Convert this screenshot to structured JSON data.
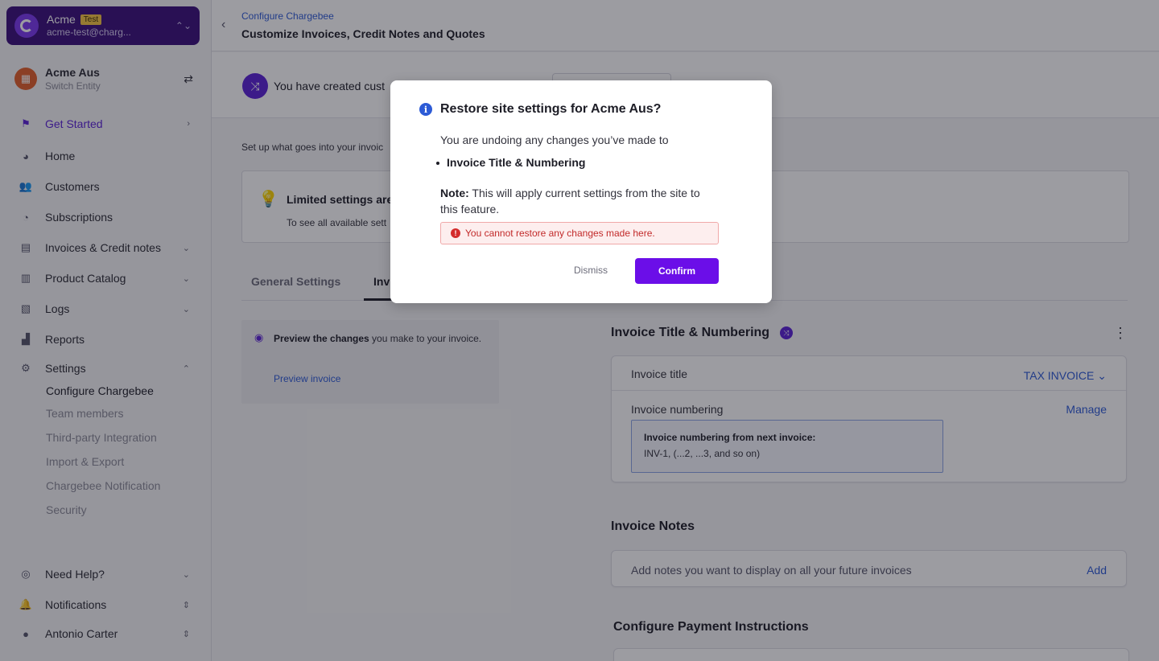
{
  "account": {
    "name": "Acme",
    "badge": "Test",
    "email": "acme-test@charg..."
  },
  "entity": {
    "name": "Acme Aus",
    "sub": "Switch Entity"
  },
  "nav": {
    "get_started": "Get Started",
    "home": "Home",
    "customers": "Customers",
    "subscriptions": "Subscriptions",
    "invoices": "Invoices & Credit notes",
    "product_catalog": "Product Catalog",
    "logs": "Logs",
    "reports": "Reports",
    "settings": "Settings",
    "settings_sub": [
      "Configure Chargebee",
      "Team members",
      "Third-party Integration",
      "Import & Export",
      "Chargebee Notification",
      "Security"
    ],
    "need_help": "Need Help?",
    "notifications": "Notifications",
    "user": "Antonio Carter"
  },
  "header": {
    "breadcrumb": "Configure Chargebee",
    "title": "Customize Invoices, Credit Notes and Quotes"
  },
  "banner": {
    "text": "You have created cust"
  },
  "setup_text": "Set up what goes into your invoic",
  "limited": {
    "title": "Limited settings are",
    "text": "To see all available sett"
  },
  "tabs": {
    "general": "General Settings",
    "invoices": "Inv"
  },
  "preview": {
    "bold": "Preview the changes",
    "rest": " you make to your invoice.",
    "link": "Preview invoice"
  },
  "title_numbering": {
    "heading": "Invoice Title & Numbering",
    "title_label": "Invoice title",
    "title_value": "TAX INVOICE",
    "numbering_label": "Invoice numbering",
    "manage": "Manage",
    "box_heading": "Invoice numbering from next invoice:",
    "box_value": "INV-1, (...2, ...3, and so on)"
  },
  "notes": {
    "heading": "Invoice Notes",
    "text": "Add notes you want to display on all your future invoices",
    "add": "Add"
  },
  "payment": {
    "heading": "Configure Payment Instructions"
  },
  "modal": {
    "title": "Restore site settings for Acme Aus?",
    "body": "You are undoing any changes you’ve made to",
    "bullet": "Invoice Title & Numbering",
    "note_label": "Note:",
    "note_text": " This will apply current settings from the site to this feature.",
    "error": "You cannot restore any changes made here.",
    "dismiss": "Dismiss",
    "confirm": "Confirm"
  },
  "colors": {
    "accent": "#6b0ee8",
    "link": "#2d5bd6",
    "error": "#c22a2a"
  }
}
